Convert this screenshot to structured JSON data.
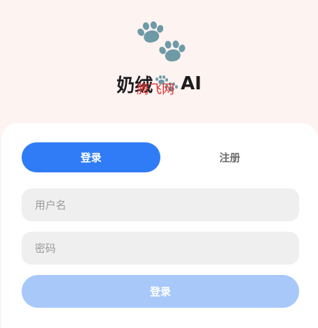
{
  "brand": {
    "name_prefix": "奶绒",
    "name_suffix": "AI",
    "logo_icon": "paw-prints-icon",
    "logo_color": "#6e9aa6"
  },
  "tabs": [
    {
      "label": "登录",
      "active": true
    },
    {
      "label": "注册",
      "active": false
    }
  ],
  "form": {
    "username_placeholder": "用户名",
    "username_value": "",
    "password_placeholder": "密码",
    "password_value": "",
    "submit_label": "登录"
  },
  "overlay": {
    "watermark_text": "腾飞网"
  },
  "colors": {
    "accent": "#2f7cf6",
    "submit_disabled": "#a8c8fa",
    "background": "#fdf3f1",
    "card": "#ffffff",
    "field": "#efefef",
    "watermark": "#e0312e"
  }
}
